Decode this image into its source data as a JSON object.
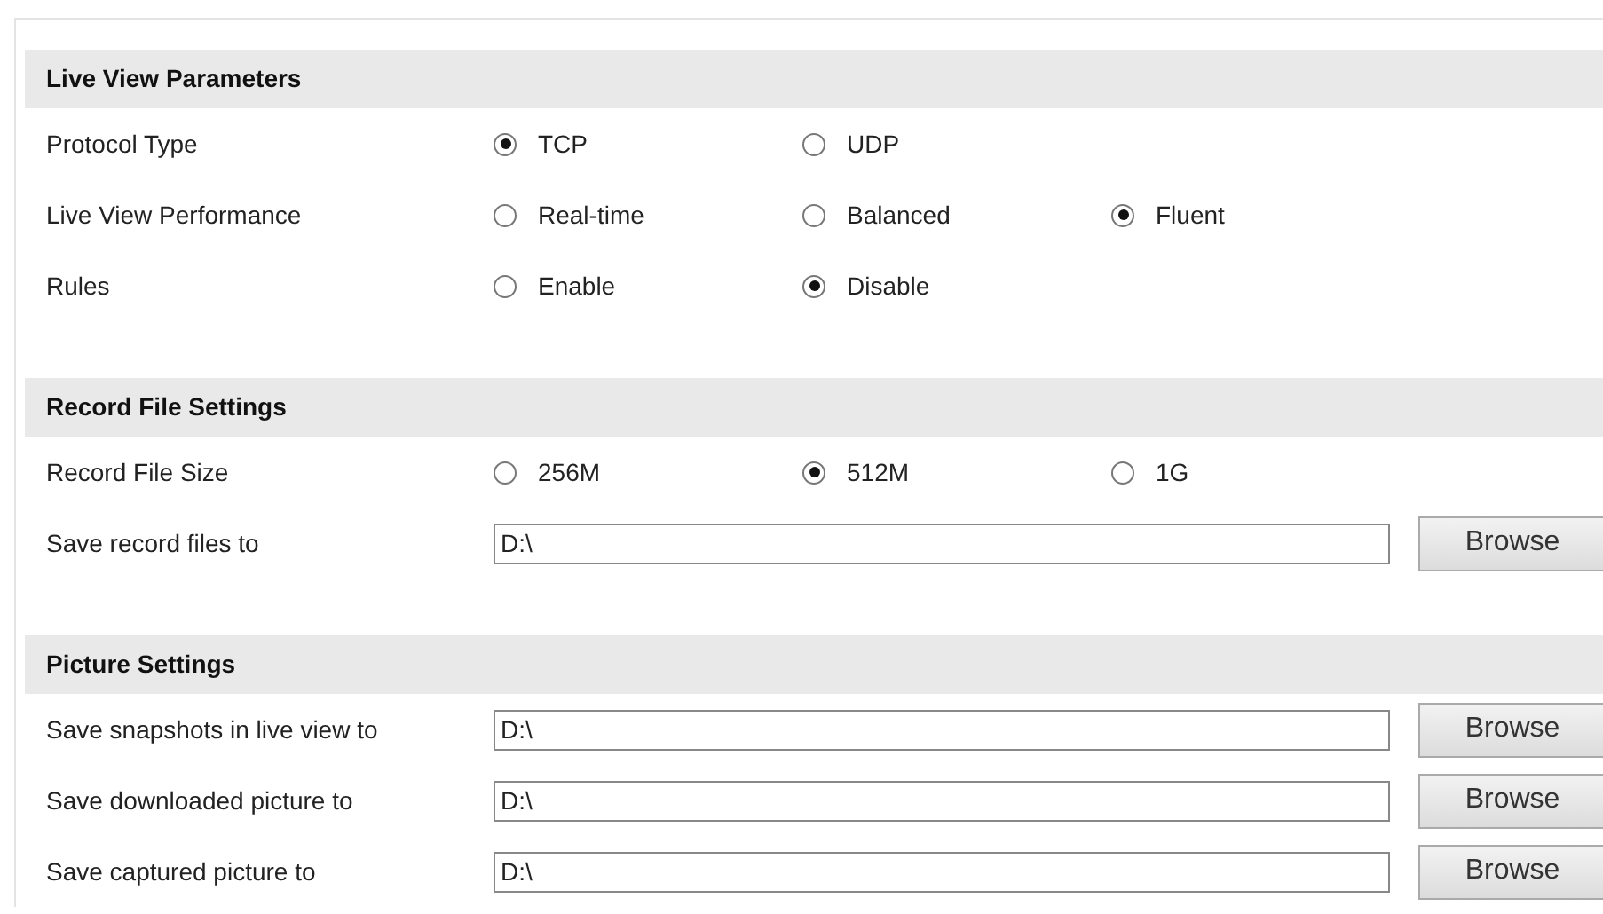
{
  "sections": [
    {
      "title": "Live View Parameters",
      "rows": [
        {
          "kind": "radio",
          "label": "Protocol Type",
          "options": [
            {
              "label": "TCP",
              "selected": true
            },
            {
              "label": "UDP",
              "selected": false
            }
          ]
        },
        {
          "kind": "radio",
          "label": "Live View Performance",
          "options": [
            {
              "label": "Real-time",
              "selected": false
            },
            {
              "label": "Balanced",
              "selected": false
            },
            {
              "label": "Fluent",
              "selected": true
            }
          ]
        },
        {
          "kind": "radio",
          "label": "Rules",
          "options": [
            {
              "label": "Enable",
              "selected": false
            },
            {
              "label": "Disable",
              "selected": true
            }
          ]
        }
      ]
    },
    {
      "title": "Record File Settings",
      "rows": [
        {
          "kind": "radio",
          "label": "Record File Size",
          "options": [
            {
              "label": "256M",
              "selected": false
            },
            {
              "label": "512M",
              "selected": true
            },
            {
              "label": "1G",
              "selected": false
            }
          ]
        },
        {
          "kind": "path",
          "label": "Save record files to",
          "value": "D:\\",
          "button": "Browse"
        }
      ]
    },
    {
      "title": "Picture Settings",
      "rows": [
        {
          "kind": "path",
          "label": "Save snapshots in live view to",
          "value": "D:\\",
          "button": "Browse"
        },
        {
          "kind": "path",
          "label": "Save downloaded picture to",
          "value": "D:\\",
          "button": "Browse"
        },
        {
          "kind": "path",
          "label": "Save captured picture to",
          "value": "D:\\",
          "button": "Browse"
        }
      ]
    }
  ]
}
